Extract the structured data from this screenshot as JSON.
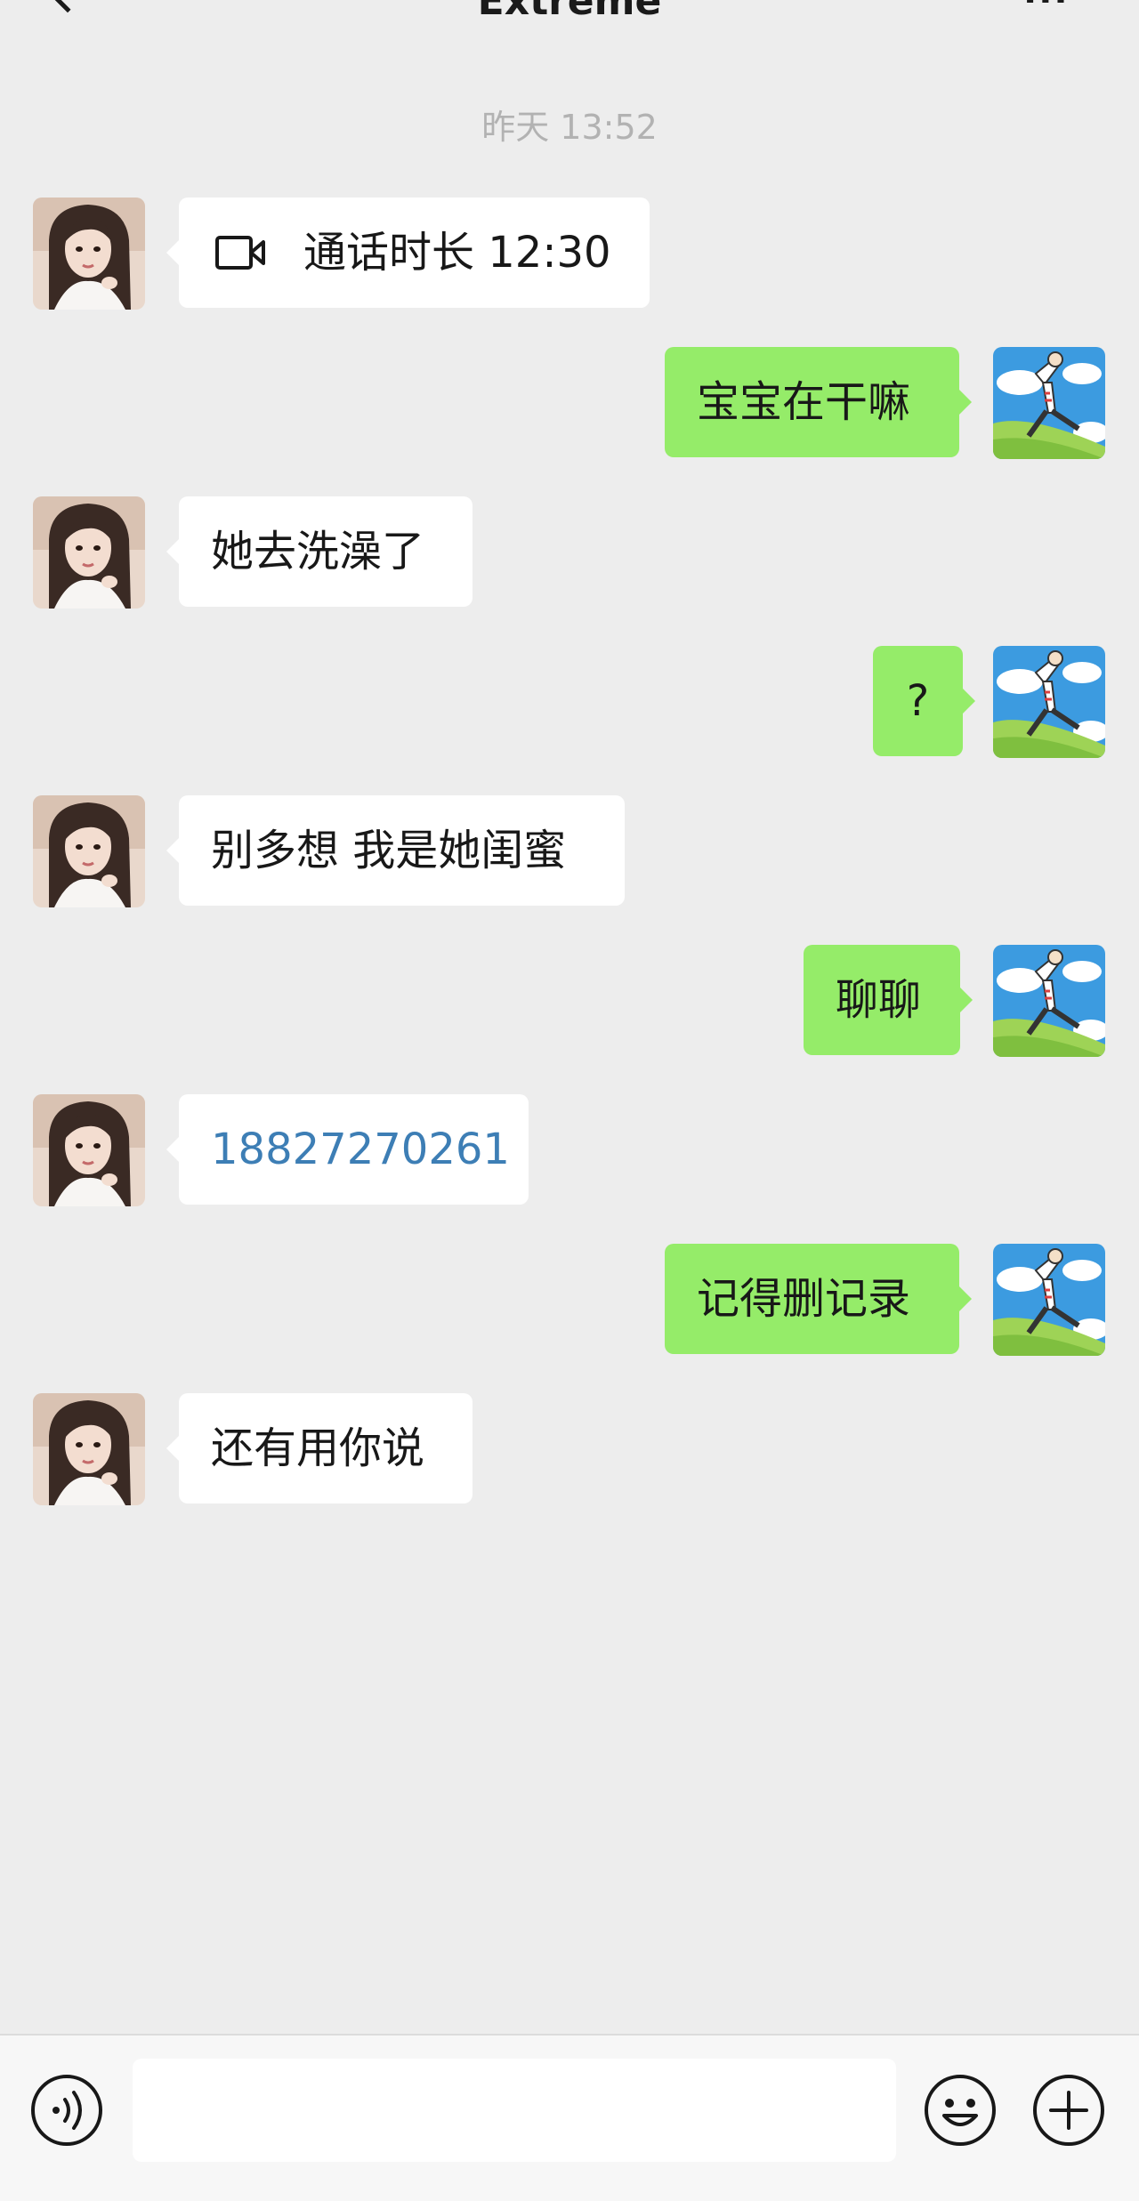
{
  "header": {
    "title": "Extreme",
    "back_icon": "chevron-left-icon",
    "more_icon": "ellipsis-icon"
  },
  "timestamp": "昨天 13:52",
  "messages": [
    {
      "sender": "contact",
      "type": "video-call",
      "text": "通话时长 12:30",
      "icon": "video-camera-icon"
    },
    {
      "sender": "me",
      "type": "text",
      "text": "宝宝在干嘛"
    },
    {
      "sender": "contact",
      "type": "text",
      "text": "她去洗澡了"
    },
    {
      "sender": "me",
      "type": "text",
      "text": "?"
    },
    {
      "sender": "contact",
      "type": "text",
      "text": "别多想 我是她闺蜜"
    },
    {
      "sender": "me",
      "type": "text",
      "text": "聊聊"
    },
    {
      "sender": "contact",
      "type": "phone-number",
      "text": "18827270261"
    },
    {
      "sender": "me",
      "type": "text",
      "text": "记得删记录"
    },
    {
      "sender": "contact",
      "type": "text",
      "text": "还有用你说"
    }
  ],
  "input_bar": {
    "text_value": "",
    "voice_icon": "voice-icon",
    "emoji_icon": "emoji-icon",
    "plus_icon": "plus-icon"
  },
  "colors": {
    "background": "#ededed",
    "bubble_out": "#95ec69",
    "bubble_in": "#ffffff",
    "link": "#3d7eb5",
    "timestamp": "#b2b2b2"
  }
}
